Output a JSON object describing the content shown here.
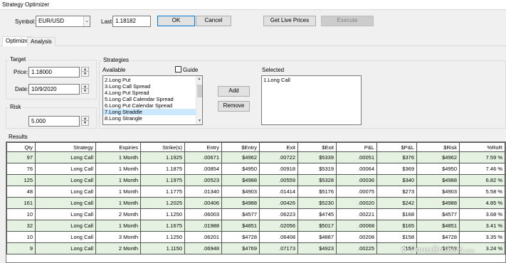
{
  "window": {
    "title": "Strategy Optimizer"
  },
  "toolbar": {
    "symbol_label": "Symbol:",
    "symbol_value": "EUR/USD",
    "last_label": "Last:",
    "last_value": "1.18182",
    "ok_label": "OK",
    "cancel_label": "Cancel",
    "live_prices_label": "Get Live Prices",
    "execute_label": "Execute"
  },
  "tabs": [
    {
      "label": "Optimize",
      "active": true
    },
    {
      "label": "Analysis",
      "active": false
    }
  ],
  "target": {
    "group_label": "Target",
    "price_label": "Price:",
    "price_value": "1.18000",
    "date_label": "Date:",
    "date_value": "10/9/2020"
  },
  "risk": {
    "group_label": "Risk",
    "value": "5.000"
  },
  "strategies": {
    "group_label": "Strategies",
    "available_label": "Available",
    "guide_label": "Guide",
    "guide_checked": false,
    "selected_label": "Selected",
    "available_items": [
      "2.Long Put",
      "3.Long Call Spread",
      "4.Long Put Spread",
      "5.Long Call Calendar Spread",
      "6.Long Put Calendar Spread",
      "7.Long Straddle",
      "8.Long Strangle"
    ],
    "highlighted_index": 5,
    "selected_items": [
      "1.Long Call"
    ],
    "add_label": "Add",
    "remove_label": "Remove"
  },
  "results": {
    "group_label": "Results",
    "columns": [
      "Qty",
      "Strategy",
      "Expiries",
      "Strike(s)",
      "Entry",
      "$Entry",
      "Exit",
      "$Exit",
      "P&L",
      "$P&L",
      "$Risk",
      "%RoR"
    ],
    "rows": [
      [
        "97",
        "Long Call",
        "1 Month",
        "1.1925",
        ".00671",
        "$4962",
        ".00722",
        "$5339",
        ".00051",
        "$376",
        "$4962",
        "7.59 %"
      ],
      [
        "76",
        "Long Call",
        "1 Month",
        "1.1875",
        ".00854",
        "$4950",
        ".00918",
        "$5319",
        ".00064",
        "$369",
        "$4950",
        "7.46 %"
      ],
      [
        "125",
        "Long Call",
        "1 Month",
        "1.1975",
        ".00523",
        "$4988",
        ".00559",
        "$5328",
        ".00036",
        "$340",
        "$4988",
        "6.82 %"
      ],
      [
        "48",
        "Long Call",
        "1 Month",
        "1.1775",
        ".01340",
        "$4903",
        ".01414",
        "$5176",
        ".00075",
        "$273",
        "$4903",
        "5.58 %"
      ],
      [
        "161",
        "Long Call",
        "1 Month",
        "1.2025",
        ".00406",
        "$4988",
        ".00426",
        "$5230",
        ".00020",
        "$242",
        "$4988",
        "4.85 %"
      ],
      [
        "10",
        "Long Call",
        "2 Month",
        "1.1250",
        ".06003",
        "$4577",
        ".06223",
        "$4745",
        ".00221",
        "$168",
        "$4577",
        "3.68 %"
      ],
      [
        "32",
        "Long Call",
        "1 Month",
        "1.1675",
        ".01988",
        "$4851",
        ".02056",
        "$5017",
        ".00068",
        "$165",
        "$4851",
        "3.41 %"
      ],
      [
        "10",
        "Long Call",
        "3 Month",
        "1.1250",
        ".06201",
        "$4728",
        ".06408",
        "$4887",
        ".00208",
        "$158",
        "$4728",
        "3.35 %"
      ],
      [
        "9",
        "Long Call",
        "2 Month",
        "1.1150",
        ".06948",
        "$4769",
        ".07173",
        "$4923",
        ".00225",
        "$154",
        "$4769",
        "3.24 %"
      ]
    ]
  },
  "watermark": {
    "text": "ForexBrokers",
    "suffix": ".com"
  },
  "colors": {
    "row_alt": "#e6f2e1",
    "list_highlight": "#cce8ff",
    "ok_border": "#0078d7"
  }
}
